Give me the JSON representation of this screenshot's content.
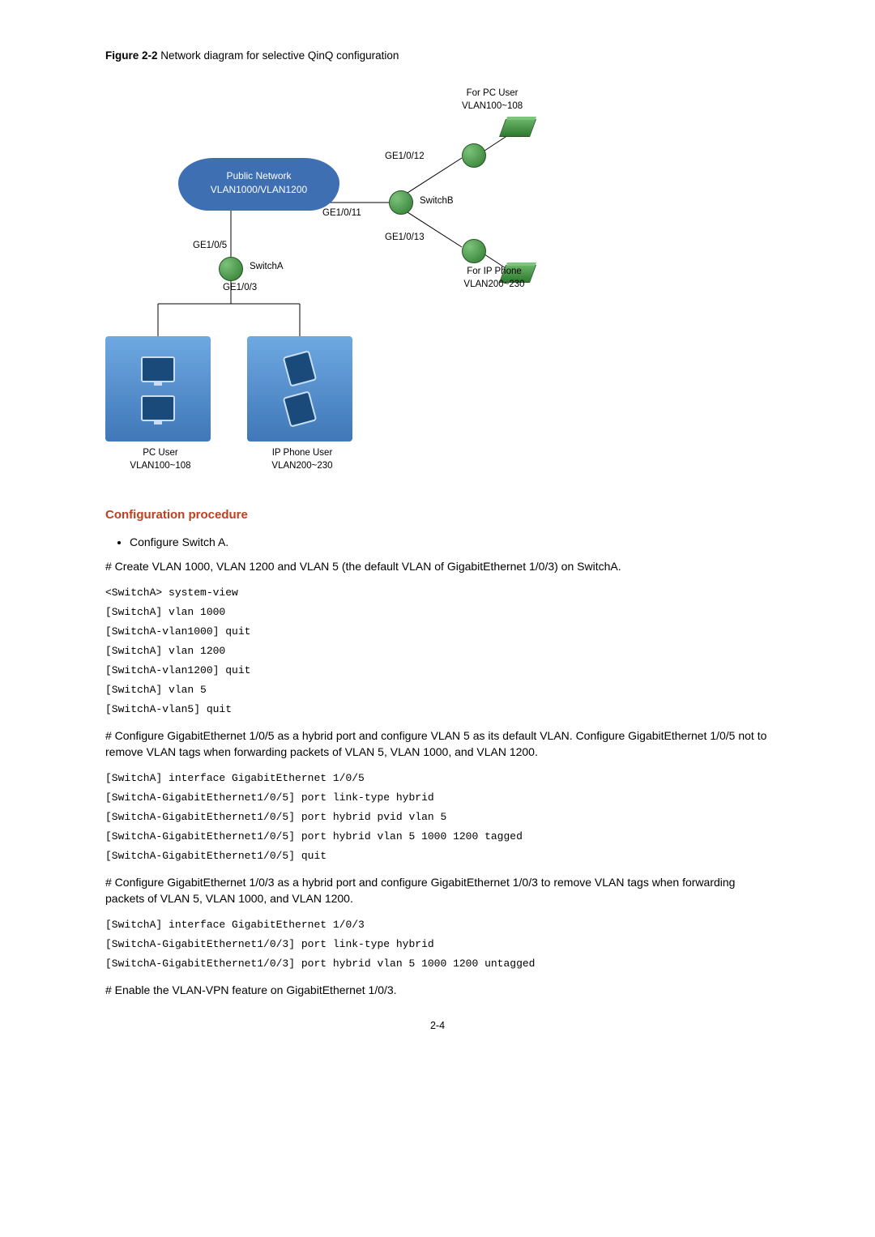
{
  "figure": {
    "label": "Figure 2-2",
    "caption": "Network diagram for selective QinQ configuration",
    "labels": {
      "pc_user_top": "For PC User\nVLAN100~108",
      "ip_phone_right": "For IP Phone\nVLAN200~230",
      "cloud_line1": "Public Network",
      "cloud_line2": "VLAN1000/VLAN1200",
      "ge_1_0_12": "GE1/0/12",
      "ge_1_0_11": "GE1/0/11",
      "ge_1_0_13": "GE1/0/13",
      "ge_1_0_5": "GE1/0/5",
      "ge_1_0_3": "GE1/0/3",
      "switchA": "SwitchA",
      "switchB": "SwitchB",
      "pc_user_bottom": "PC User\nVLAN100~108",
      "ip_phone_user_bottom": "IP Phone User\nVLAN200~230"
    }
  },
  "section_heading": "Configuration procedure",
  "bullets": [
    "Configure Switch A."
  ],
  "para1": "# Create VLAN 1000, VLAN 1200 and VLAN 5 (the default VLAN of GigabitEthernet 1/0/3) on SwitchA.",
  "code1": "<SwitchA> system-view\n[SwitchA] vlan 1000\n[SwitchA-vlan1000] quit\n[SwitchA] vlan 1200\n[SwitchA-vlan1200] quit\n[SwitchA] vlan 5\n[SwitchA-vlan5] quit",
  "para2": "# Configure GigabitEthernet 1/0/5 as a hybrid port and configure VLAN 5 as its default VLAN. Configure GigabitEthernet 1/0/5 not to remove VLAN tags when forwarding packets of VLAN 5, VLAN 1000, and VLAN 1200.",
  "code2": "[SwitchA] interface GigabitEthernet 1/0/5\n[SwitchA-GigabitEthernet1/0/5] port link-type hybrid\n[SwitchA-GigabitEthernet1/0/5] port hybrid pvid vlan 5\n[SwitchA-GigabitEthernet1/0/5] port hybrid vlan 5 1000 1200 tagged\n[SwitchA-GigabitEthernet1/0/5] quit",
  "para3": "# Configure GigabitEthernet 1/0/3 as a hybrid port and configure GigabitEthernet 1/0/3 to remove VLAN tags when forwarding packets of VLAN 5, VLAN 1000, and VLAN 1200.",
  "code3": "[SwitchA] interface GigabitEthernet 1/0/3\n[SwitchA-GigabitEthernet1/0/3] port link-type hybrid\n[SwitchA-GigabitEthernet1/0/3] port hybrid vlan 5 1000 1200 untagged",
  "para4": "# Enable the VLAN-VPN feature on GigabitEthernet 1/0/3.",
  "page_number": "2-4"
}
